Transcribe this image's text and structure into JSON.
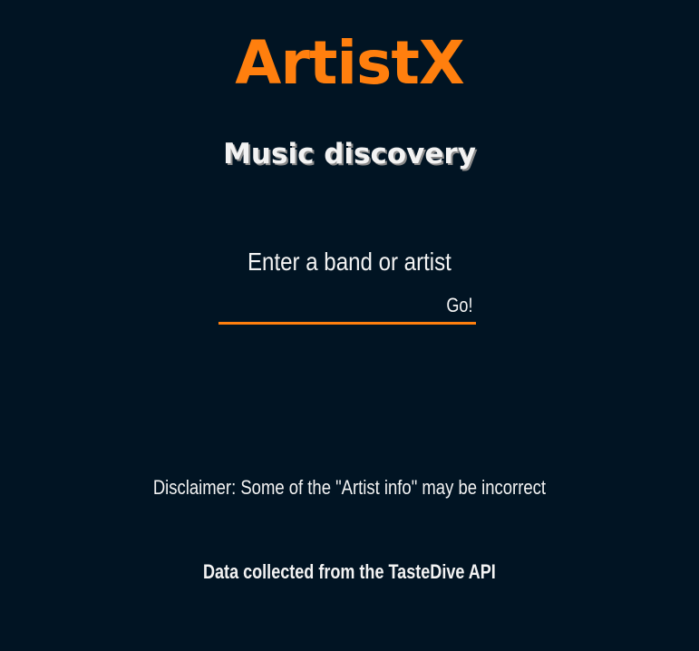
{
  "header": {
    "logo_text": "ArtistX",
    "subtitle": "Music discovery"
  },
  "search": {
    "label": "Enter a band or artist",
    "value": "",
    "placeholder": "",
    "button_label": "Go!"
  },
  "footer": {
    "disclaimer": "Disclaimer: Some of the \"Artist info\" may be incorrect",
    "credit": "Data collected from the TasteDive API"
  },
  "colors": {
    "background": "#011423",
    "accent": "#ff7f0e",
    "text": "#f3f3f3"
  }
}
